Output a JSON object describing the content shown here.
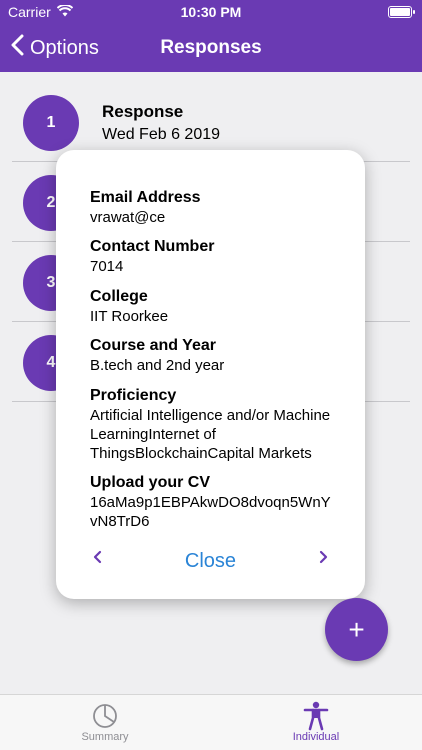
{
  "status_bar": {
    "carrier": "Carrier",
    "time": "10:30 PM"
  },
  "nav": {
    "back_label": "Options",
    "title": "Responses"
  },
  "rows": [
    {
      "number": "1",
      "title": "Response",
      "date": "Wed Feb 6 2019"
    },
    {
      "number": "2"
    },
    {
      "number": "3"
    },
    {
      "number": "4"
    }
  ],
  "popup": {
    "fields": [
      {
        "label": "Email Address",
        "value": "vrawat@ce"
      },
      {
        "label": "Contact Number",
        "value": "7014"
      },
      {
        "label": "College",
        "value": "IIT Roorkee"
      },
      {
        "label": "Course and Year",
        "value": "B.tech and 2nd year"
      },
      {
        "label": "Proficiency",
        "value": "Artificial Intelligence and/or Machine LearningInternet of ThingsBlockchainCapital Markets"
      },
      {
        "label": "Upload your CV",
        "value": "16aMa9p1EBPAkwDO8dvoqn5WnYvN8TrD6"
      }
    ],
    "prev_icon": "chevron-left-icon",
    "next_icon": "chevron-right-icon",
    "close_label": "Close"
  },
  "fab": {
    "label": "+"
  },
  "tabbar": {
    "tabs": [
      {
        "label": "Summary",
        "icon": "pie-chart-icon",
        "color": "#8e8e93"
      },
      {
        "label": "Individual",
        "icon": "person-icon",
        "color": "#6a3ab3"
      }
    ]
  },
  "colors": {
    "primary": "#6a3ab3",
    "link": "#2a84d6"
  }
}
